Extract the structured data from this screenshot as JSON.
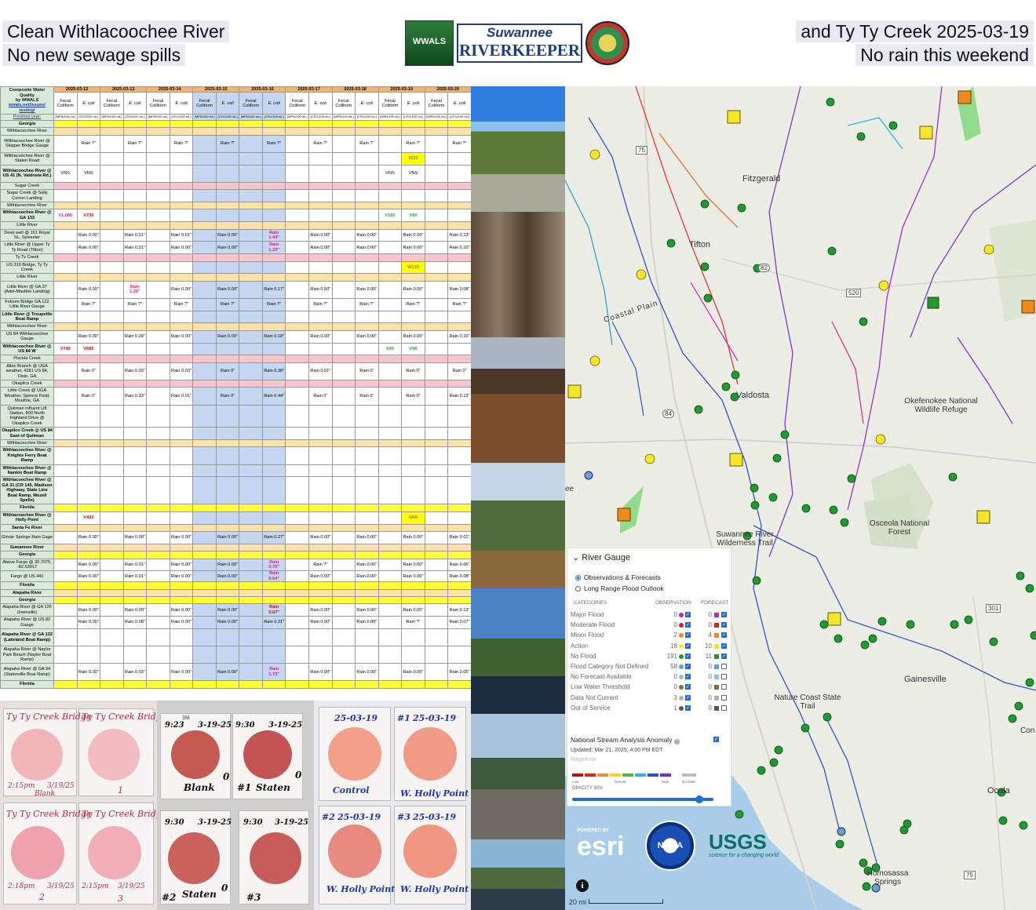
{
  "header": {
    "left_line1": "Clean Withlacoochee River",
    "left_line2": "No new sewage spills",
    "right_line1": "and Ty Ty Creek 2025-03-19",
    "right_line2": "No rain this weekend",
    "logo_wwals": "WWALS",
    "logo_rk_top": "Suwannee",
    "logo_rk_bottom": "RIVERKEEPER"
  },
  "table": {
    "corner": [
      "Composite Water",
      "Quality",
      "by WWALS",
      "wwals.net/issues/",
      "testing/"
    ],
    "previous_year": "Previous year:",
    "dates": [
      "2025-03-12",
      "2025-03-13",
      "2025-03-14",
      "2025-03-15",
      "2025-03-16",
      "2025-03-17",
      "2025-03-18",
      "2025-03-19",
      "2025-03-20"
    ],
    "col_fecal": "Fecal Coliform",
    "col_ecoli": "E. coli",
    "unit_fecal": "(MPN/100 mL)",
    "unit_ecoli": "(CFU/100 mL)",
    "rows": [
      {
        "site": "Georgia",
        "kind": "yellow",
        "bold": true,
        "cells": []
      },
      {
        "site": "Withlacoochee River",
        "kind": "cream",
        "cells": []
      },
      {
        "site": "Withlacoochee River @ Skipper Bridge Gauge",
        "kind": "plain",
        "cells": [
          "",
          "Rain ?\"",
          "",
          "Rain ?\"",
          "",
          "Rain ?\"",
          "",
          "Rain ?\"",
          "",
          "Rain ?\"",
          "",
          "Rain ?\"",
          "",
          "Rain ?\"",
          "",
          "Rain ?\"",
          "",
          "Rain ?\""
        ]
      },
      {
        "site": "Withlacoochee River @ Staten Road",
        "kind": "plain",
        "cells": [
          "",
          "",
          "",
          "",
          "",
          "",
          "",
          "",
          "",
          "",
          "",
          "",
          "",
          "",
          "",
          "W33",
          "",
          ""
        ],
        "yl": [
          15
        ]
      },
      {
        "site": "Withlacoochee River @ US 41 (N. Valdosta Rd.)",
        "kind": "plain",
        "bold": true,
        "cells": [
          "VNS",
          "VNS",
          "",
          "",
          "",
          "",
          "",
          "",
          "",
          "",
          "",
          "",
          "",
          "",
          "VNS",
          "VNS",
          "",
          ""
        ]
      },
      {
        "site": "Sugar Creek",
        "kind": "pink",
        "cells": []
      },
      {
        "site": "Sugar Creek @ Sally Corner Landing",
        "kind": "plain",
        "cells": []
      },
      {
        "site": "Withlacoochee River",
        "kind": "cream",
        "cells": []
      },
      {
        "site": "Withlacoochee River @ GA 133",
        "kind": "plain",
        "bold": true,
        "cells": [
          "V1,005",
          "V735",
          "",
          "",
          "",
          "",
          "",
          "",
          "",
          "",
          "",
          "",
          "",
          "",
          "V160",
          "V60",
          "",
          ""
        ],
        "colors": {
          "0": "pk",
          "1": "rd",
          "14": "gr",
          "15": "gr"
        }
      },
      {
        "site": "Little River",
        "kind": "cream",
        "cells": []
      },
      {
        "site": "Deep well @ 161 Royal St., Sylvester",
        "kind": "plain",
        "cells": [
          "",
          "Rain 0.00\"",
          "",
          "Rain 0.01\"",
          "",
          "Rain 0.01\"",
          "",
          "Rain 0.00\"",
          "",
          "Rain 1.44\"",
          "",
          "Rain 0.00\"",
          "",
          "Rain 0.00\"",
          "",
          "Rain 0.00\"",
          "",
          "Rain 0.13\""
        ],
        "colors": {
          "9": "pk"
        }
      },
      {
        "site": "Little River @ Upper Ty Ty Road (Tifton)",
        "kind": "plain",
        "cells": [
          "",
          "Rain 0.00\"",
          "",
          "Rain 0.01\"",
          "",
          "Rain 0.00\"",
          "",
          "Rain 0.00\"",
          "",
          "Rain 1.20\"",
          "",
          "Rain 0.00\"",
          "",
          "Rain 0.00\"",
          "",
          "Rain 0.00\"",
          "",
          "Rain 0.10\""
        ],
        "colors": {
          "9": "pk"
        }
      },
      {
        "site": "Ty Ty Creek",
        "kind": "pink",
        "cells": []
      },
      {
        "site": "US 319 Bridge, Ty Ty Creek",
        "kind": "plain",
        "cells": [
          "",
          "",
          "",
          "",
          "",
          "",
          "",
          "",
          "",
          "",
          "",
          "",
          "",
          "",
          "",
          "W133",
          "",
          ""
        ],
        "yl": [
          15
        ]
      },
      {
        "site": "Little River",
        "kind": "cream",
        "cells": []
      },
      {
        "site": "Little River @ GA 37 (Adel-Moultrie Landing)",
        "kind": "plain",
        "cells": [
          "",
          "Rain 0.00\"",
          "",
          "Rain 1.26\"",
          "",
          "Rain 0.00\"",
          "",
          "Rain 0.00\"",
          "",
          "Rain 0.17\"",
          "",
          "Rain 0.00\"",
          "",
          "Rain 0.00\"",
          "",
          "Rain 0.00\"",
          "",
          "Rain 0.08\""
        ],
        "colors": {
          "3": "pk"
        }
      },
      {
        "site": "Folsom Bridge GA 122 Little River Gauge",
        "kind": "plain",
        "cells": [
          "",
          "Rain ?\"",
          "",
          "Rain ?\"",
          "",
          "Rain ?\"",
          "",
          "Rain ?\"",
          "",
          "Rain ?\"",
          "",
          "Rain ?\"",
          "",
          "Rain ?\"",
          "",
          "Rain ?\"",
          "",
          "Rain ?\""
        ]
      },
      {
        "site": "Little River @ Troupville Boat Ramp",
        "kind": "plain",
        "bold": true,
        "cells": []
      },
      {
        "site": "Withlacoochee River",
        "kind": "cream",
        "cells": []
      },
      {
        "site": "US 84 Withlacoochee Gauge",
        "kind": "plain",
        "cells": [
          "",
          "Rain 0.00\"",
          "",
          "Rain 0.09\"",
          "",
          "Rain 0.00\"",
          "",
          "Rain 0.00\"",
          "",
          "Rain 0.18\"",
          "",
          "Rain 0.00\"",
          "",
          "Rain 0.00\"",
          "",
          "Rain 0.00\"",
          "",
          "Rain 0.10\""
        ]
      },
      {
        "site": "Withlacoochee River @ US 84 W",
        "kind": "plain",
        "bold": true,
        "cells": [
          "V740",
          "V685",
          "",
          "",
          "",
          "",
          "",
          "",
          "",
          "",
          "",
          "",
          "",
          "",
          "V20",
          "V40",
          "",
          ""
        ],
        "colors": {
          "0": "rd",
          "1": "rd",
          "14": "gr",
          "15": "gr"
        }
      },
      {
        "site": "Piscola Creek",
        "kind": "pink",
        "cells": []
      },
      {
        "site": "Allen Branch @ UGA weather, 4281 US 84, Dixie, GA",
        "kind": "plain",
        "cells": [
          "",
          "Rain 0\"",
          "",
          "Rain 0.03\"",
          "",
          "Rain 0.03\"",
          "",
          "Rain 0\"",
          "",
          "Rain 0.38\"",
          "",
          "Rain 0.01\"",
          "",
          "Rain 0\"",
          "",
          "Rain 0\"",
          "",
          "Rain 0\""
        ]
      },
      {
        "site": "Okapilco Creek",
        "kind": "pink",
        "cells": []
      },
      {
        "site": "Little Creek @ UGA Weather, Spence Field, Moultrie, GA",
        "kind": "plain",
        "cells": [
          "",
          "Rain 0\"",
          "",
          "Rain 0.33\"",
          "",
          "Rain 0.01\"",
          "",
          "Rain 0\"",
          "",
          "Rain 0.44\"",
          "",
          "Rain 0\"",
          "",
          "Rain 0\"",
          "",
          "Rain 0\"",
          "",
          "Rain 0.13\""
        ]
      },
      {
        "site": "Quitman Influent Lift Station, 800 North Highland Drive @ Okapilco Creek",
        "kind": "plain",
        "cells": []
      },
      {
        "site": "Okapilco Creek @ US 84 East of Quitman",
        "kind": "plain",
        "bold": true,
        "cells": []
      },
      {
        "site": "Withlacoochee River",
        "kind": "cream",
        "cells": []
      },
      {
        "site": "Withlacoochee River @ Knights Ferry Boat Ramp",
        "kind": "plain",
        "bold": true,
        "cells": []
      },
      {
        "site": "Withlacoochee River @ Nankin Boat Ramp",
        "kind": "plain",
        "bold": true,
        "cells": []
      },
      {
        "site": "Withlacoochee River @ GA 31 (CR 145, Madison Highway, State Line Boat Ramp, Mozell Spells)",
        "kind": "plain",
        "bold": true,
        "cells": []
      },
      {
        "site": "Florida",
        "kind": "yellow",
        "bold": true,
        "cells": []
      },
      {
        "site": "Withlacoochee River @ Holly Point",
        "kind": "plain",
        "bold": true,
        "cells": [
          "",
          "V433",
          "",
          "",
          "",
          "",
          "",
          "",
          "",
          "",
          "",
          "",
          "",
          "",
          "",
          "W66",
          "",
          ""
        ],
        "colors": {
          "1": "rd"
        },
        "yl": [
          15
        ]
      },
      {
        "site": "Santa Fe River",
        "kind": "cream",
        "bold": true,
        "cells": []
      },
      {
        "site": "Ginnie Springs Rain Gage",
        "kind": "plain",
        "cells": [
          "",
          "Rain 0.00\"",
          "",
          "Rain 0.00\"",
          "",
          "Rain 0.00\"",
          "",
          "Rain 0.00\"",
          "",
          "Rain 0.27\"",
          "",
          "Rain 0.00\"",
          "",
          "Rain 0.00\"",
          "",
          "Rain 0.00\"",
          "",
          "Rain 0.01\""
        ]
      },
      {
        "site": "Suwannee River",
        "kind": "cream",
        "bold": true,
        "cells": []
      },
      {
        "site": "Georgia",
        "kind": "yellow",
        "bold": true,
        "cells": []
      },
      {
        "site": "Above Fargo @ 30.7075, -82.53917",
        "kind": "plain",
        "cells": [
          "",
          "Rain 0.00\"",
          "",
          "Rain 0.01\"",
          "",
          "Rain 0.00\"",
          "",
          "Rain 0.00\"",
          "",
          "Rain 0.76\"",
          "",
          "Rain ?\"",
          "",
          "Rain 0.00\"",
          "",
          "Rain 0.00\"",
          "",
          "Rain 0.06\""
        ],
        "colors": {
          "9": "pk"
        }
      },
      {
        "site": "Fargo @ US 441",
        "kind": "plain",
        "cells": [
          "",
          "Rain 0.00\"",
          "",
          "Rain 0.01\"",
          "",
          "Rain 0.00\"",
          "",
          "Rain 0.00\"",
          "",
          "Rain 0.64\"",
          "",
          "Rain 0.00\"",
          "",
          "Rain 0.00\"",
          "",
          "Rain 0.00\"",
          "",
          "Rain 0.08\""
        ],
        "colors": {
          "9": "pk"
        }
      },
      {
        "site": "Florida",
        "kind": "yellow",
        "bold": true,
        "cells": []
      },
      {
        "site": "Alapaha River",
        "kind": "cream",
        "bold": true,
        "cells": []
      },
      {
        "site": "Georgia",
        "kind": "yellow",
        "bold": true,
        "cells": []
      },
      {
        "site": "Alapaha River @ GA 125 (Irwinville)",
        "kind": "plain",
        "cells": [
          "",
          "Rain 0.00\"",
          "",
          "Rain 0.00\"",
          "",
          "Rain 0.00\"",
          "",
          "Rain 0.00\"",
          "",
          "Rain 0.67\"",
          "",
          "Rain 0.00\"",
          "",
          "Rain 0.00\"",
          "",
          "Rain 0.00\"",
          "",
          "Rain 0.13\""
        ],
        "colors": {
          "9": "rd"
        }
      },
      {
        "site": "Alapaha River @ US 82 Gauge",
        "kind": "plain",
        "cells": [
          "",
          "Rain 0.00\"",
          "",
          "Rain 0.08\"",
          "",
          "Rain 0.00\"",
          "",
          "Rain 0.00\"",
          "",
          "Rain 0.21\"",
          "",
          "Rain 0.00\"",
          "",
          "Rain 0.00\"",
          "",
          "Rain ?\"",
          "",
          "Rain 0.07\""
        ]
      },
      {
        "site": "Alapaha River @ GA 122 (Lakeland Boat Ramp)",
        "kind": "plain",
        "bold": true,
        "cells": []
      },
      {
        "site": "Alapaha River @ Naylor Park Beach (Naylor Boat Ramp)",
        "kind": "plain",
        "cells": []
      },
      {
        "site": "Alapaha River @ GA 94 (Statenville Boat Ramp)",
        "kind": "plain",
        "cells": [
          "",
          "Rain 0.00\"",
          "",
          "Rain 0.03\"",
          "",
          "Rain 0.00\"",
          "",
          "Rain 0.00\"",
          "",
          "Rain 2.73\"",
          "",
          "Rain 0.00\"",
          "",
          "Rain 0.00\"",
          "",
          "Rain 0.00\"",
          "",
          "Rain 0.05\""
        ],
        "colors": {
          "9": "pk"
        }
      },
      {
        "site": "Florida",
        "kind": "yellow",
        "bold": true,
        "cells": []
      }
    ]
  },
  "petri": {
    "p1": [
      "Ty Ty Creek Bridge",
      "Ty Ty Creek Bridge",
      "2:15pm",
      "3/19/25",
      "Blank",
      "1",
      "Ty Ty Creek Bridge",
      "Ty Ty Creek Bridge",
      "2:18pm",
      "3/19/25",
      "2",
      "2:15pm",
      "3/19/25",
      "3"
    ],
    "p2": [
      "9:23",
      "3-19-25",
      "Blank",
      "0",
      "9:30",
      "3-19-25",
      "#1",
      "Staten",
      "0",
      "9:30",
      "3-19-25",
      "#2",
      "Staten",
      "0",
      "9:30",
      "3-19-25",
      "#3"
    ],
    "p3": [
      "25-03-19",
      "Control",
      "#1",
      "25-03-19",
      "W. Holly Point",
      "#2",
      "25-03-19",
      "W. Holly Point",
      "#3",
      "25-03-19",
      "W. Holly Point"
    ],
    "brand": "3M"
  },
  "map": {
    "places": [
      "Fitzgerald",
      "Tifton",
      "Coastal Plain",
      "Valdosta",
      "Okefenokee National Wildlife Refuge",
      "Osceola National Forest",
      "Suwannee River Wilderness Trail",
      "Nature Coast State Trail",
      "Gainesville",
      "Ocala",
      "Homosassa Springs",
      "ee",
      "Con"
    ],
    "shields": [
      "75",
      "82",
      "520",
      "84",
      "301",
      "75"
    ],
    "scale": "20 mi"
  },
  "legend": {
    "title": "River Gauge",
    "opt1": "Observations & Forecasts",
    "opt2": "Long Range Flood Outlook",
    "h_categories": "CATEGORIES",
    "h_obs": "OBSERVATION",
    "h_fc": "FORECAST",
    "rows": [
      {
        "label": "Major Flood",
        "obs": "0",
        "fc": "0",
        "color": "#c021c0",
        "fc_checked": true
      },
      {
        "label": "Moderate Flood",
        "obs": "0",
        "fc": "0",
        "color": "#e0201f",
        "fc_checked": true
      },
      {
        "label": "Minor Flood",
        "obs": "2",
        "fc": "4",
        "color": "#f08a1d",
        "fc_checked": true
      },
      {
        "label": "Action",
        "obs": "18",
        "fc": "10",
        "color": "#f3e62b",
        "fc_checked": true
      },
      {
        "label": "No Flood",
        "obs": "191",
        "fc": "11",
        "color": "#1e9b2e",
        "fc_checked": true
      },
      {
        "label": "Flood Category Not Defined",
        "obs": "58",
        "fc": "0",
        "color": "#62a0d8",
        "fc_checked": false
      },
      {
        "label": "No Forecast Available",
        "obs": "0",
        "fc": "0",
        "color": "#9ab8e0",
        "fc_checked": false
      },
      {
        "label": "Low Water Threshold",
        "obs": "0",
        "fc": "0",
        "color": "#8a6a3a",
        "fc_checked": false
      },
      {
        "label": "Data Not Current",
        "obs": "3",
        "fc": "0",
        "color": "#b0b0b0",
        "fc_checked": false
      },
      {
        "label": "Out of Service",
        "obs": "1",
        "fc": "0",
        "color": "#555555",
        "fc_checked": false
      }
    ],
    "nsa": "National Stream Analysis Anomaly",
    "updated": "Updated: Mar 21, 2025, 4:00 PM EDT",
    "magnitude": "Magnitude",
    "ramp_low": "Low",
    "ramp_normal": "Normal",
    "ramp_high": "High",
    "ramp_nodata": "No Data",
    "opacity": "OPACITY 90%",
    "opacity_value": 0.9
  },
  "logos": {
    "esri_powered": "POWERED BY",
    "esri": "esri",
    "noaa": "NOAA",
    "usgs": "USGS",
    "usgs_tag": "science for a changing world"
  }
}
